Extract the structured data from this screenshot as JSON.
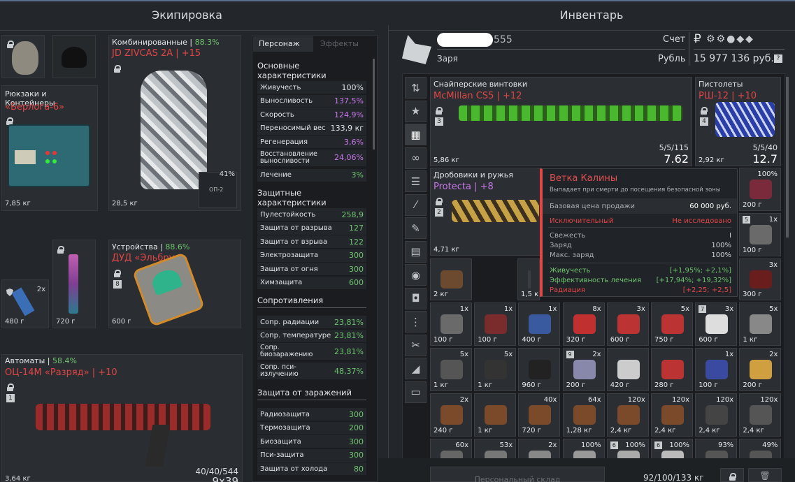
{
  "headers": {
    "equipment": "Экипировка",
    "inventory": "Инвентарь"
  },
  "equipment": {
    "armor": {
      "type": "Комбинированные",
      "pct": "88.3%",
      "name": "JD ZIVCAS 2A | +15",
      "weight": "28,5 кг",
      "durability": "41%",
      "chip": "ОП-2"
    },
    "backpack": {
      "type": "Рюкзаки и Контейнеры",
      "name": "«Берлога-6»",
      "weight": "7,85 кг"
    },
    "device": {
      "type": "Устройства",
      "pct": "88.6%",
      "name": "ДУД «Эльбрус»",
      "slot": "8",
      "weight": "600 г"
    },
    "small1": {
      "count": "2x",
      "weight": "480 г"
    },
    "knife": {
      "weight": "720 г"
    },
    "rifle": {
      "type": "Автоматы",
      "pct": "58.4%",
      "name": "ОЦ-14М «Разряд» | +10",
      "slot": "1",
      "ammo": "40/40/544",
      "caliber": "9x39",
      "weight": "3,64 кг"
    }
  },
  "stats": {
    "tab_char": "Персонаж",
    "tab_effects": "Эффекты",
    "basic_title": "Основные характеристики",
    "basic": [
      [
        "Живучесть",
        "100%"
      ],
      [
        "Выносливость",
        "137,5%"
      ],
      [
        "Скорость",
        "124,9%"
      ],
      [
        "Переносимый вес",
        "133,9 кг"
      ],
      [
        "Регенерация",
        "3,6%"
      ],
      [
        "Восстановление выносливости",
        "24,06%"
      ],
      [
        "Лечение",
        "3%"
      ]
    ],
    "protect_title": "Защитные характеристики",
    "protect": [
      [
        "Пулестойкость",
        "258,9"
      ],
      [
        "Защита от разрыва",
        "127"
      ],
      [
        "Защита от взрыва",
        "122"
      ],
      [
        "Электрозащита",
        "300"
      ],
      [
        "Защита от огня",
        "300"
      ],
      [
        "Химзащита",
        "600"
      ]
    ],
    "resist_title": "Сопротивления",
    "resist": [
      [
        "Сопр. радиации",
        "23,81%"
      ],
      [
        "Сопр. температуре",
        "23,81%"
      ],
      [
        "Сопр. биозаражению",
        "23,81%"
      ],
      [
        "Сопр. пси-излучению",
        "48,37%"
      ]
    ],
    "infect_title": "Защита от заражений",
    "infect": [
      [
        "Радиозащита",
        "300"
      ],
      [
        "Термозащита",
        "200"
      ],
      [
        "Биозащита",
        "300"
      ],
      [
        "Пси-защита",
        "300"
      ],
      [
        "Защита от холода",
        "80"
      ]
    ]
  },
  "profile": {
    "name_suffix": "555",
    "faction": "Заря",
    "account_label": "Счет",
    "currency_label": "Рубль",
    "balance": "15 977 136 руб.",
    "help": "?"
  },
  "weapons": {
    "sniper": {
      "type": "Снайперские винтовки",
      "name": "McMillan CS5 | +12",
      "slot": "3",
      "weight": "5,86 кг",
      "ammo": "5/5/115",
      "caliber": "7.62"
    },
    "pistol": {
      "type": "Пистолеты",
      "name": "РШ-12 | +10",
      "slot": "4",
      "weight": "2,92 кг",
      "ammo": "5/5/40",
      "caliber": "12.7"
    },
    "shotgun": {
      "type": "Дробовики и ружья",
      "name": "Protecta | +8",
      "slot": "2",
      "weight": "4,71 кг"
    }
  },
  "tooltip": {
    "title": "Ветка Калины",
    "desc": "Выпадает при смерти до посещения безопасной зоны",
    "price_label": "Базовая цена продажи",
    "price": "60 000 руб.",
    "rarity": "Исключительный",
    "research": "Не исследовано",
    "fresh_label": "Свежесть",
    "fresh": "I",
    "charge_label": "Заряд",
    "charge": "100%",
    "maxcharge_label": "Макс. заряд",
    "maxcharge": "100%",
    "e1": "Живучесть",
    "e1v": "[+1,95%; +2,1%]",
    "e2": "Эффективность лечения",
    "e2v": "[+17,94%; +19,32%]",
    "e3": "Радиация",
    "e3v": "[+2,25; +2,5]"
  },
  "grid": [
    {
      "c": "",
      "w": "2 кг"
    },
    {
      "c": "",
      "w": "1,5 к"
    },
    {
      "c": "100%",
      "w": "200 г"
    },
    {
      "c": "1x",
      "w": "100 г",
      "s": "5"
    },
    {
      "c": "3x",
      "w": "300 г"
    },
    {
      "c": "1x",
      "w": "100 г"
    },
    {
      "c": "1x",
      "w": "100 г"
    },
    {
      "c": "1x",
      "w": "400 г"
    },
    {
      "c": "8x",
      "w": "320 г"
    },
    {
      "c": "3x",
      "w": "600 г"
    },
    {
      "c": "5x",
      "w": "750 г"
    },
    {
      "c": "3x",
      "w": "600 г",
      "s": "7"
    },
    {
      "c": "5x",
      "w": "1 кг"
    },
    {
      "c": "5x",
      "w": "1 кг"
    },
    {
      "c": "5x",
      "w": "1 кг"
    },
    {
      "c": "",
      "w": "960 г"
    },
    {
      "c": "2x",
      "w": "200 г",
      "s": "9"
    },
    {
      "c": "",
      "w": "420 г"
    },
    {
      "c": "",
      "w": "280 г"
    },
    {
      "c": "1x",
      "w": "100 г"
    },
    {
      "c": "2x",
      "w": "200 г"
    },
    {
      "c": "2x",
      "w": "240 г"
    },
    {
      "c": "",
      "w": "1 кг"
    },
    {
      "c": "40x",
      "w": "720 г"
    },
    {
      "c": "64x",
      "w": "1,28 кг"
    },
    {
      "c": "120x",
      "w": "2,4 кг"
    },
    {
      "c": "120x",
      "w": "2,4 кг"
    },
    {
      "c": "120x",
      "w": "2,4 кг"
    },
    {
      "c": "120x",
      "w": "2,4 кг"
    },
    {
      "c": "60x",
      "w": ""
    },
    {
      "c": "53x",
      "w": ""
    },
    {
      "c": "2x",
      "w": ""
    },
    {
      "c": "100%",
      "w": ""
    },
    {
      "c": "100%",
      "w": "",
      "s": "6"
    },
    {
      "c": "100%",
      "w": "",
      "s": "6"
    },
    {
      "c": "93%",
      "w": ""
    },
    {
      "c": "49%",
      "w": ""
    }
  ],
  "footer": {
    "storage": "Персональный склад",
    "weight": "92/100/133 кг"
  }
}
